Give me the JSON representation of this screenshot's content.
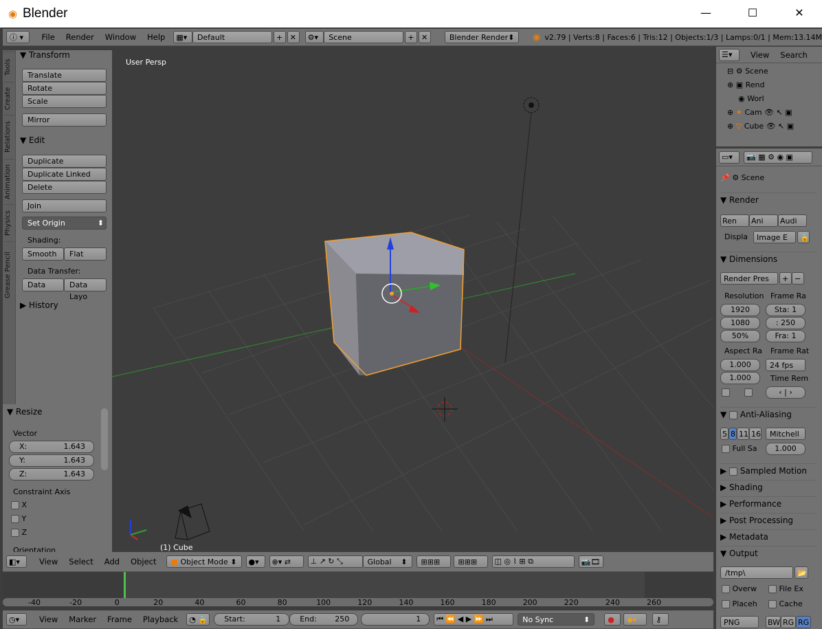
{
  "window": {
    "title": "Blender",
    "minimize": "—",
    "maximize": "☐",
    "close": "✕"
  },
  "top_menu": {
    "items": [
      "File",
      "Render",
      "Window",
      "Help"
    ],
    "layout": "Default",
    "scene": "Scene",
    "engine": "Blender Render",
    "stats": "v2.79 | Verts:8 | Faces:6 | Tris:12 | Objects:1/3 | Lamps:0/1 | Mem:13.14M"
  },
  "tool_tabs": [
    "Tools",
    "Create",
    "Relations",
    "Animation",
    "Physics",
    "Grease Pencil"
  ],
  "tools": {
    "transform_header": "Transform",
    "translate": "Translate",
    "rotate": "Rotate",
    "scale": "Scale",
    "mirror": "Mirror",
    "edit_header": "Edit",
    "duplicate": "Duplicate",
    "duplicate_linked": "Duplicate Linked",
    "delete": "Delete",
    "join": "Join",
    "set_origin": "Set Origin",
    "shading_label": "Shading:",
    "smooth": "Smooth",
    "flat": "Flat",
    "data_transfer_label": "Data Transfer:",
    "data": "Data",
    "data_layo": "Data Layo",
    "history_header": "History"
  },
  "redo": {
    "header": "Resize",
    "vector_label": "Vector",
    "x_label": "X:",
    "x": "1.643",
    "y_label": "Y:",
    "y": "1.643",
    "z_label": "Z:",
    "z": "1.643",
    "constraint_label": "Constraint Axis",
    "cx": "X",
    "cy": "Y",
    "cz": "Z",
    "orientation": "Orientation"
  },
  "viewport": {
    "perspective": "User Persp",
    "object_label": "(1) Cube"
  },
  "view_header": {
    "view": "View",
    "select": "Select",
    "add": "Add",
    "object": "Object",
    "mode": "Object Mode",
    "orientation": "Global"
  },
  "timeline": {
    "ticks": [
      "-40",
      "-20",
      "0",
      "20",
      "40",
      "60",
      "80",
      "100",
      "120",
      "140",
      "160",
      "180",
      "200",
      "220",
      "240",
      "260"
    ]
  },
  "timeline_header": {
    "view": "View",
    "marker": "Marker",
    "frame": "Frame",
    "playback": "Playback",
    "start": "Start:",
    "start_val": "1",
    "end": "End:",
    "end_val": "250",
    "current": "1",
    "sync": "No Sync"
  },
  "outliner": {
    "view": "View",
    "search": "Search",
    "items": [
      "Scene",
      "Rend",
      "Worl",
      "Cam",
      "Cube"
    ]
  },
  "properties": {
    "scene": "Scene",
    "render_header": "Render",
    "ren": "Ren",
    "ani": "Ani",
    "audi": "Audi",
    "displa": "Displa",
    "image_e": "Image E",
    "dimensions_header": "Dimensions",
    "render_pres": "Render Pres",
    "resolution": "Resolution",
    "frame_ra": "Frame Ra",
    "res_x": "1920",
    "res_y": "1080",
    "res_pct": "50%",
    "sta": "Sta: 1",
    "end": ": 250",
    "fra": "Fra: 1",
    "aspect_ra": "Aspect Ra",
    "frame_rat": "Frame Rat",
    "asp_x": "1.000",
    "asp_y": "1.000",
    "fps": "24 fps",
    "time_rem": "Time Rem",
    "aa_header": "Anti-Aliasing",
    "aa5": "5",
    "aa8": "8",
    "aa11": "11",
    "aa16": "16",
    "mitchell": "Mitchell",
    "full_sa": "Full Sa",
    "filter": "1.000",
    "sampled_motion": "Sampled Motion",
    "shading": "Shading",
    "performance": "Performance",
    "post_processing": "Post Processing",
    "metadata": "Metadata",
    "output": "Output",
    "path": "/tmp\\",
    "overw": "Overw",
    "file_ex": "File Ex",
    "placeh": "Placeh",
    "cache": "Cache",
    "png": "PNG",
    "bw": "BW",
    "rg": "RG",
    "rgb": "RG"
  },
  "colors": {
    "accent": "#e87d0d",
    "selected_outline": "#f0a030",
    "x_axis": "#c03030",
    "y_axis": "#30a030",
    "z_axis": "#2040e0"
  }
}
